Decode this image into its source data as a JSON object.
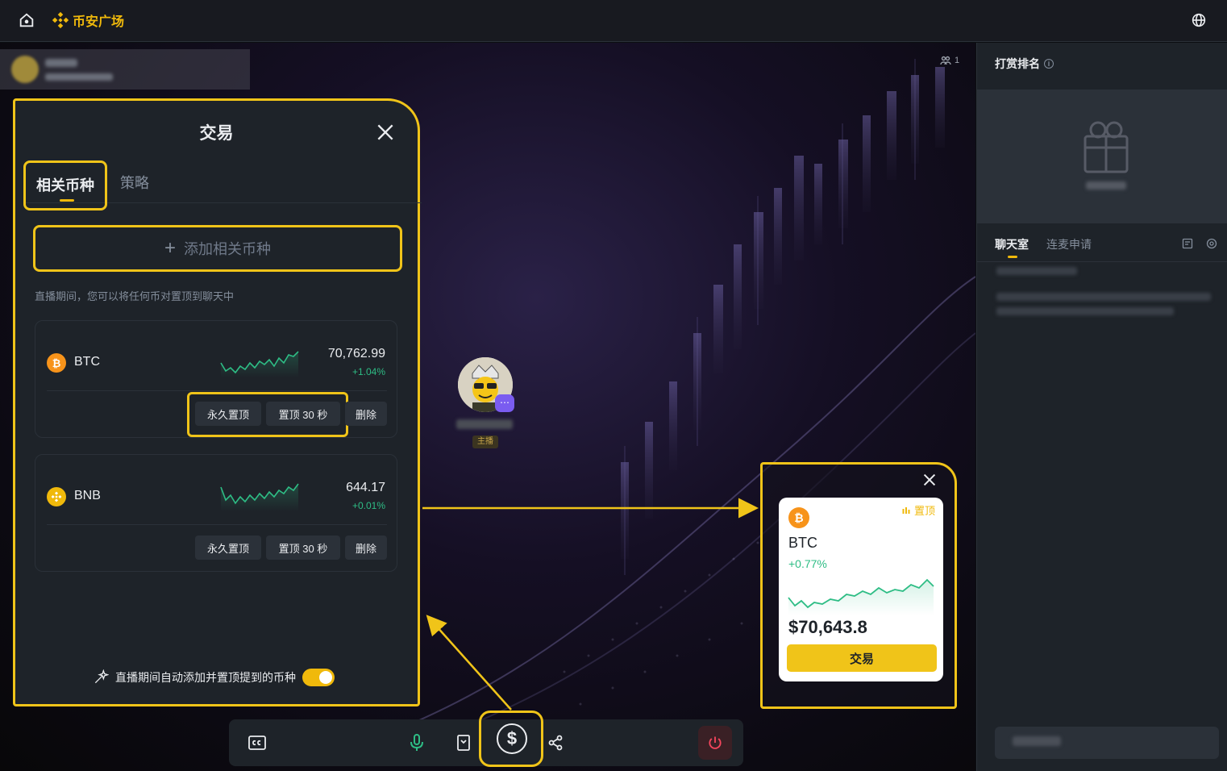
{
  "topbar": {
    "logo_text": "币安广场"
  },
  "stage": {
    "viewer_count": "1",
    "host_role": "主播"
  },
  "trade_panel": {
    "title": "交易",
    "tabs": [
      {
        "label": "相关币种"
      },
      {
        "label": "策略"
      }
    ],
    "add_label": "添加相关币种",
    "hint": "直播期间，您可以将任何币对置顶到聊天中",
    "coins": [
      {
        "symbol": "BTC",
        "price": "70,762.99",
        "change": "+1.04%",
        "icon_color": "#f7931a",
        "actions": {
          "pin_forever": "永久置顶",
          "pin_30s": "置顶 30 秒",
          "delete": "删除"
        }
      },
      {
        "symbol": "BNB",
        "price": "644.17",
        "change": "+0.01%",
        "icon_color": "#f0b90b",
        "actions": {
          "pin_forever": "永久置顶",
          "pin_30s": "置顶 30 秒",
          "delete": "删除"
        }
      }
    ],
    "auto_add_label": "直播期间自动添加并置顶提到的币种",
    "auto_add_enabled": true
  },
  "preview": {
    "pin_label": "置顶",
    "symbol": "BTC",
    "change": "+0.77%",
    "price": "$70,643.8",
    "trade_label": "交易"
  },
  "sidebar": {
    "ranking_title": "打赏排名",
    "chat_tabs": [
      {
        "label": "聊天室"
      },
      {
        "label": "连麦申请"
      }
    ]
  },
  "colors": {
    "accent": "#f0b90b",
    "highlight": "#f0c419",
    "up": "#2ebd85",
    "panel": "#1e2329"
  },
  "icons": [
    "home-icon",
    "binance-logo-icon",
    "globe-icon",
    "close-icon",
    "plus-icon",
    "bitcoin-icon",
    "bnb-icon",
    "sparkle-icon",
    "cc-icon",
    "mic-icon",
    "bookmark-icon",
    "dollar-icon",
    "share-icon",
    "power-icon",
    "info-icon",
    "gift-icon",
    "pin-icon"
  ]
}
